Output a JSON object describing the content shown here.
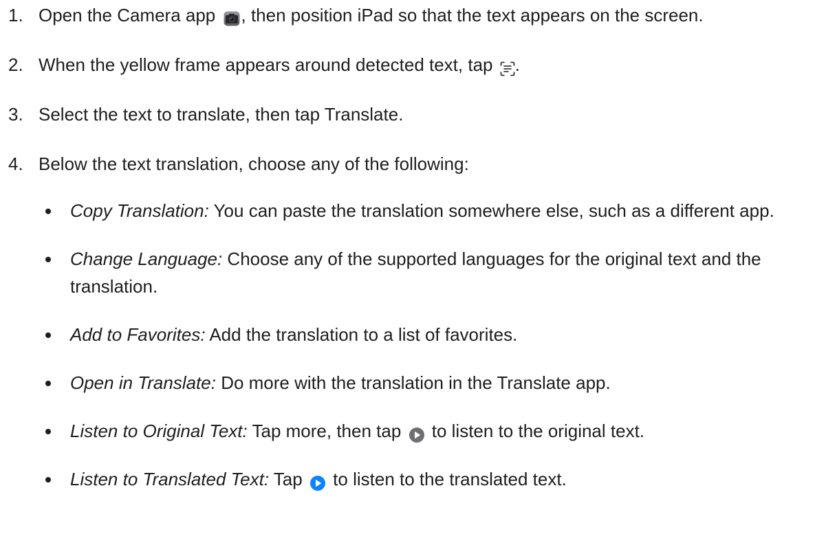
{
  "steps": [
    {
      "number": "1.",
      "text_before": "Open the Camera app ",
      "icon": "camera-app-icon",
      "text_after": ", then position iPad so that the text appears on the screen."
    },
    {
      "number": "2.",
      "text_before": "When the yellow frame appears around detected text, tap ",
      "icon": "live-text-icon",
      "text_after": "."
    },
    {
      "number": "3.",
      "text": "Select the text to translate, then tap Translate."
    },
    {
      "number": "4.",
      "text": "Below the text translation, choose any of the following:"
    }
  ],
  "options": [
    {
      "term": "Copy Translation:",
      "description": " You can paste the translation somewhere else, such as a different app."
    },
    {
      "term": "Change Language:",
      "description": " Choose any of the supported languages for the original text and the translation."
    },
    {
      "term": "Add to Favorites:",
      "description": " Add the translation to a list of favorites."
    },
    {
      "term": "Open in Translate:",
      "description": " Do more with the translation in the Translate app."
    },
    {
      "term": "Listen to Original Text:",
      "description_before": " Tap more, then tap ",
      "icon": "play-icon",
      "icon_color": "#6e6e73",
      "description_after": " to listen to the original text."
    },
    {
      "term": "Listen to Translated Text:",
      "description_before": " Tap ",
      "icon": "play-icon",
      "icon_color": "#0a84ff",
      "description_after": " to listen to the translated text."
    }
  ]
}
